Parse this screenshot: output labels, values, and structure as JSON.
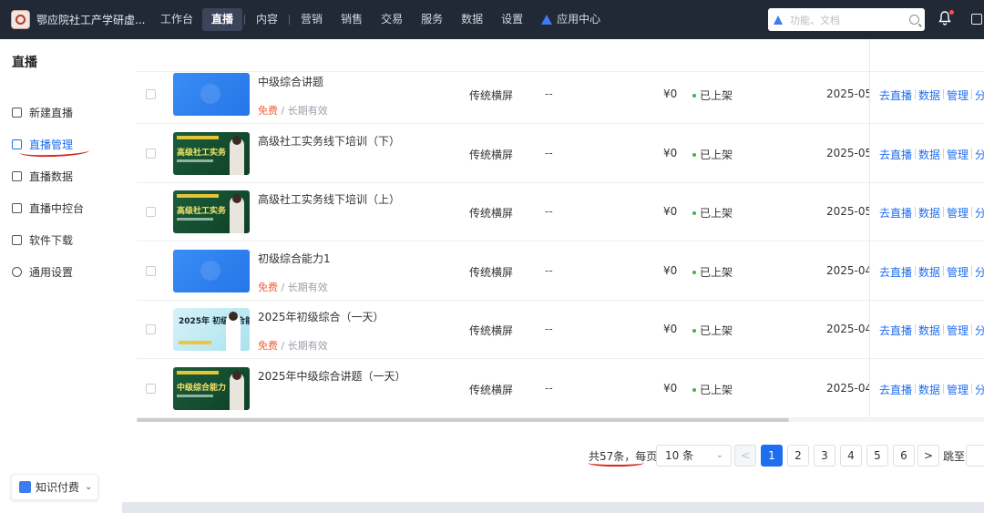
{
  "brand": {
    "name": "鄂应院社工产学研虚..."
  },
  "nav": {
    "items": [
      {
        "label": "工作台",
        "active": false
      },
      {
        "label": "直播",
        "active": true
      },
      {
        "label": "内容",
        "active": false
      },
      {
        "label": "营销",
        "active": false
      },
      {
        "label": "销售",
        "active": false
      },
      {
        "label": "交易",
        "active": false
      },
      {
        "label": "服务",
        "active": false
      },
      {
        "label": "数据",
        "active": false
      },
      {
        "label": "设置",
        "active": false
      }
    ],
    "app_center": "应用中心",
    "search_placeholder": "功能、文档"
  },
  "sidebar": {
    "title": "直播",
    "items": [
      {
        "label": "新建直播",
        "icon": "new-live-icon",
        "active": false
      },
      {
        "label": "直播管理",
        "icon": "live-manage-icon",
        "active": true
      },
      {
        "label": "直播数据",
        "icon": "live-data-icon",
        "active": false
      },
      {
        "label": "直播中控台",
        "icon": "console-icon",
        "active": false
      },
      {
        "label": "软件下载",
        "icon": "download-icon",
        "active": false
      },
      {
        "label": "通用设置",
        "icon": "settings-icon",
        "active": false
      }
    ],
    "footer_button": "知识付费"
  },
  "table": {
    "partial_row": {
      "price_free": "免费",
      "price_sep": "/",
      "price_valid": "长期有效"
    },
    "rows": [
      {
        "name": "中级综合讲题",
        "thumb": "blue",
        "thumb_text": "",
        "show_price": true,
        "type": "传统横屏",
        "dash": "--",
        "amount": "¥0",
        "status": "已上架",
        "date": "2025-05-",
        "ops": [
          "去直播",
          "数据",
          "管理",
          "分享"
        ]
      },
      {
        "name": "高级社工实务线下培训（下）",
        "thumb": "green",
        "thumb_text": "高级社工实务",
        "show_price": false,
        "type": "传统横屏",
        "dash": "--",
        "amount": "¥0",
        "status": "已上架",
        "date": "2025-05-",
        "ops": [
          "去直播",
          "数据",
          "管理",
          "分享"
        ]
      },
      {
        "name": "高级社工实务线下培训（上）",
        "thumb": "green",
        "thumb_text": "高级社工实务",
        "show_price": false,
        "type": "传统横屏",
        "dash": "--",
        "amount": "¥0",
        "status": "已上架",
        "date": "2025-05-",
        "ops": [
          "去直播",
          "数据",
          "管理",
          "分享"
        ]
      },
      {
        "name": "初级综合能力1",
        "thumb": "blue",
        "thumb_text": "",
        "show_price": true,
        "type": "传统横屏",
        "dash": "--",
        "amount": "¥0",
        "status": "已上架",
        "date": "2025-04-",
        "ops": [
          "去直播",
          "数据",
          "管理",
          "分享"
        ]
      },
      {
        "name": "2025年初级综合（一天）",
        "thumb": "light",
        "thumb_text": "2025年 初级综合能力",
        "show_price": true,
        "type": "传统横屏",
        "dash": "--",
        "amount": "¥0",
        "status": "已上架",
        "date": "2025-04-",
        "ops": [
          "去直播",
          "数据",
          "管理",
          "分享"
        ]
      },
      {
        "name": "2025年中级综合讲题（一天）",
        "thumb": "green",
        "thumb_text": "中级综合能力",
        "show_price": false,
        "type": "传统横屏",
        "dash": "--",
        "amount": "¥0",
        "status": "已上架",
        "date": "2025-04-",
        "ops": [
          "去直播",
          "数据",
          "管理",
          "分享"
        ]
      }
    ]
  },
  "pagination": {
    "total_text": "共57条，每页",
    "per_page": "10 条",
    "pages": [
      "1",
      "2",
      "3",
      "4",
      "5",
      "6"
    ],
    "current_page": "1",
    "prev": "<",
    "next": ">",
    "jump_label": "跳至"
  },
  "colors": {
    "accent": "#1f6ef0",
    "topbar": "#212836",
    "free": "#f0623d",
    "status_dot": "#3bb54a",
    "annotation_red": "#d8221c"
  }
}
